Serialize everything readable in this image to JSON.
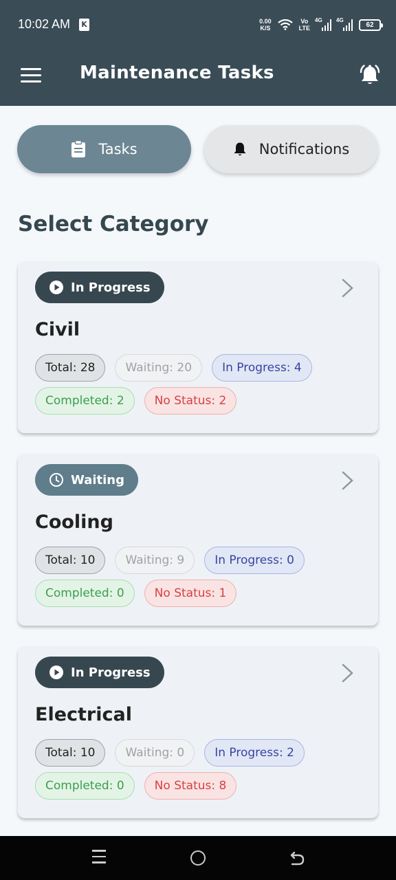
{
  "status_bar": {
    "time": "10:02 AM",
    "badge": "K",
    "net_speed_value": "0.00",
    "net_speed_unit": "K/S",
    "volte_top": "Vo",
    "volte_bottom": "LTE",
    "sim1": "4G",
    "sim2": "4G",
    "battery": "62"
  },
  "app_bar": {
    "title": "Maintenance Tasks",
    "menu_icon": "hamburger-menu-icon",
    "bell_icon": "bell-ringing-icon"
  },
  "tabs": [
    {
      "label": "Tasks",
      "icon": "clipboard-icon",
      "active": true
    },
    {
      "label": "Notifications",
      "icon": "bell-icon",
      "active": false
    }
  ],
  "section_title": "Select Category",
  "categories": [
    {
      "status": "In Progress",
      "status_icon": "play-circle-icon",
      "name": "Civil",
      "total": "Total: 28",
      "waiting": "Waiting: 20",
      "in_progress": "In Progress: 4",
      "completed": "Completed: 2",
      "no_status": "No Status: 2"
    },
    {
      "status": "Waiting",
      "status_icon": "clock-icon",
      "name": "Cooling",
      "total": "Total: 10",
      "waiting": "Waiting: 9",
      "in_progress": "In Progress: 0",
      "completed": "Completed: 0",
      "no_status": "No Status: 1"
    },
    {
      "status": "In Progress",
      "status_icon": "play-circle-icon",
      "name": "Electrical",
      "total": "Total: 10",
      "waiting": "Waiting: 0",
      "in_progress": "In Progress: 2",
      "completed": "Completed: 0",
      "no_status": "No Status: 8"
    }
  ],
  "colors": {
    "app_bar": "#3a4c56",
    "tab_active": "#6c8693",
    "chip_in_progress": "#37474f",
    "chip_waiting": "#607d8b",
    "completed": "#3c9e4c",
    "no_status": "#d84141",
    "in_progress_pill": "#3346a0"
  }
}
